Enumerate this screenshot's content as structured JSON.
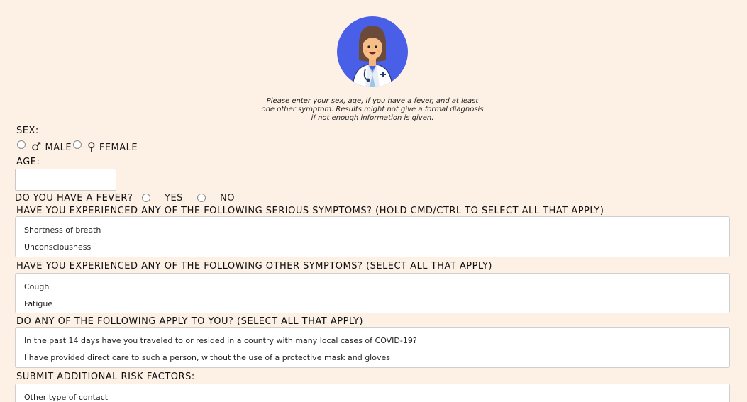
{
  "intro": "Please enter your sex, age, if you have a fever, and at least one other symptom. Results might not give a formal diagnosis if not enough information is given.",
  "sex": {
    "label": "SEX:",
    "male": {
      "symbol": "♂",
      "text": "MALE"
    },
    "female": {
      "symbol": "♀",
      "text": "FEMALE"
    }
  },
  "age": {
    "label": "AGE:",
    "value": ""
  },
  "fever": {
    "label": "DO YOU HAVE A FEVER?",
    "yes": "YES",
    "no": "NO"
  },
  "serious": {
    "label": "HAVE YOU EXPERIENCED ANY OF THE FOLLOWING SERIOUS SYMPTOMS? (HOLD CMD/CTRL TO SELECT ALL THAT APPLY)",
    "options": [
      "Shortness of breath",
      "Unconsciousness"
    ]
  },
  "other": {
    "label": "HAVE YOU EXPERIENCED ANY OF THE FOLLOWING OTHER SYMPTOMS? (SELECT ALL THAT APPLY)",
    "options": [
      "Cough",
      "Fatigue"
    ]
  },
  "apply": {
    "label": "DO ANY OF THE FOLLOWING APPLY TO YOU? (SELECT ALL THAT APPLY)",
    "options": [
      "In the past 14 days have you traveled to or resided in a country with many local cases of COVID-19?",
      "I have provided direct care to such a person, without the use of a protective mask and gloves"
    ]
  },
  "risk": {
    "label": "SUBMIT ADDITIONAL RISK FACTORS:",
    "options": [
      "Other type of contact"
    ]
  },
  "colors": {
    "background": "#fdf0e5",
    "avatar_bg": "#4a5fe8"
  },
  "icons": {
    "avatar": "doctor-avatar-icon"
  }
}
